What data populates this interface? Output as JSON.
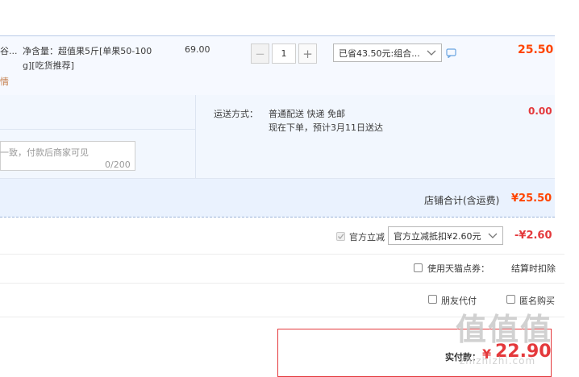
{
  "item": {
    "title_fragment": "谷...",
    "spec_line1": "净含量：超值果5斤[单果50-100",
    "spec_line2": "g][吃货推荐]",
    "detail_link": "情",
    "unit_price": "69.00",
    "qty_minus": "−",
    "qty_value": "1",
    "qty_plus": "+",
    "discount_select": "已省43.50元:组合...",
    "subtotal": "25.50"
  },
  "shipping": {
    "label": "运送方式：",
    "method": "普通配送 快递 免邮",
    "eta": "现在下单，预计3月11日送达",
    "fee": "0.00"
  },
  "message": {
    "placeholder_fragment": "一致，付款后商家可见",
    "counter": "0/200"
  },
  "store_total": {
    "label": "店铺合计(含运费)",
    "amount": "¥25.50"
  },
  "official_discount": {
    "label": "官方立减",
    "select": "官方立减抵扣¥2.60元",
    "amount": "-¥2.60"
  },
  "tmall_points": {
    "label": "使用天猫点券：",
    "note": "结算时扣除"
  },
  "options": {
    "friend_pay": "朋友代付",
    "anonymous": "匿名购买"
  },
  "payment": {
    "label": "实付款：",
    "currency": "¥",
    "amount": "22.90"
  },
  "watermark": {
    "logo": "值",
    "site": "zhizhizhi.com"
  },
  "colors": {
    "accent_red": "#ff4400",
    "pay_red": "#e4393c",
    "row_bg": "#f6f9ff"
  }
}
